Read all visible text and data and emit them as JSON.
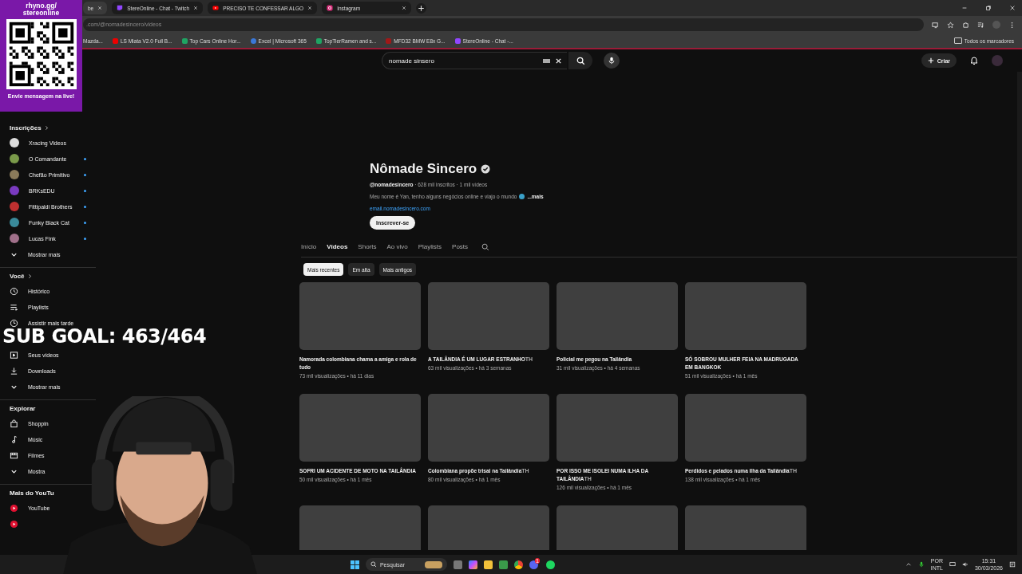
{
  "browser": {
    "tabs": [
      {
        "title": "be",
        "kind": "none",
        "selected": true
      },
      {
        "title": "StereOnline - Chat - Twitch",
        "kind": "twitch",
        "selected": false
      },
      {
        "title": "PRECISO TE CONFESSAR ALGO",
        "kind": "youtube",
        "selected": false
      },
      {
        "title": "Instagram",
        "kind": "instagram",
        "selected": false
      }
    ],
    "address": ".com/@nomadesincero/videos",
    "bookmarks": [
      {
        "title": "Mazda...",
        "kind": "none"
      },
      {
        "title": "LS Miata V2.0 Full B...",
        "kind": "youtube"
      },
      {
        "title": "Top Cars Online Hor...",
        "kind": "sheet"
      },
      {
        "title": "Excel | Microsoft 365",
        "kind": "office"
      },
      {
        "title": "TopTierRamen and s...",
        "kind": "sheet"
      },
      {
        "title": "MFD32 BMW E8x G...",
        "kind": "car"
      },
      {
        "title": "StereOnline - Chat -...",
        "kind": "twitch"
      }
    ],
    "all_bookmarks": "Todos os marcadores"
  },
  "header": {
    "search": {
      "value": "nomade sinsero"
    },
    "create_button": "Criar"
  },
  "sidebar": [
    {
      "title": "Inscrições",
      "items": [
        {
          "label": "Xracing Videos",
          "kind": "avatar",
          "new": false
        },
        {
          "label": "O Comandante",
          "kind": "avatar",
          "new": true
        },
        {
          "label": "Chefão Primitivo",
          "kind": "avatar",
          "new": true
        },
        {
          "label": "BRKsEDU",
          "kind": "avatar",
          "new": true
        },
        {
          "label": "Fittipaldi Brothers",
          "kind": "avatar",
          "new": true
        },
        {
          "label": "Funky Black Cat",
          "kind": "avatar",
          "new": true
        },
        {
          "label": "Lucas Fink",
          "kind": "avatar",
          "new": true
        },
        {
          "label": "Mostrar mais",
          "kind": "more"
        }
      ]
    },
    {
      "title": "Você",
      "items": [
        {
          "label": "Histórico",
          "kind": "history"
        },
        {
          "label": "Playlists",
          "kind": "playlists"
        },
        {
          "label": "Assistir mais tarde",
          "kind": "clock"
        },
        {
          "kind": "hidden"
        },
        {
          "label": "Seus vídeos",
          "kind": "video"
        },
        {
          "label": "Downloads",
          "kind": "download"
        },
        {
          "label": "Mostrar mais",
          "kind": "more"
        }
      ]
    },
    {
      "title": "Explorar",
      "items": [
        {
          "label": "Shoppin",
          "kind": "bag"
        },
        {
          "label": "Músic",
          "kind": "music"
        },
        {
          "label": "Filmes",
          "kind": "film"
        },
        {
          "label": "Mostra",
          "kind": "more"
        }
      ]
    },
    {
      "title": "Mais do YouTu",
      "items": [
        {
          "label": "YouTube",
          "kind": "youtube"
        },
        {
          "kind": "youtube"
        }
      ]
    }
  ],
  "channel": {
    "name": "Nômade Sincero",
    "verified": true,
    "handle": "@nomadesincero",
    "stats": "· 628 mil inscritos · 1 mil vídeos",
    "description": "Meu nome é Yan, tenho alguns negócios online e viajo o mundo",
    "more": "...mais",
    "link": "email.nomadesincero.com",
    "subscribe_button": "Inscrever-se",
    "tabs": [
      {
        "label": "Início",
        "selected": false
      },
      {
        "label": "Vídeos",
        "selected": true
      },
      {
        "label": "Shorts",
        "selected": false
      },
      {
        "label": "Ao vivo",
        "selected": false
      },
      {
        "label": "Playlists",
        "selected": false
      },
      {
        "label": "Posts",
        "selected": false
      }
    ],
    "chips": [
      {
        "label": "Mais recentes",
        "selected": true
      },
      {
        "label": "Em alta",
        "selected": false
      },
      {
        "label": "Mais antigos",
        "selected": false
      }
    ]
  },
  "videos": [
    {
      "title": "Namorada colombiana chama a amiga e rola de tudo",
      "meta": "73 mil visualizações • há 11 dias"
    },
    {
      "title": "A TAILÂNDIA É UM LUGAR ESTRANHO",
      "badge": "TH",
      "meta": "63 mil visualizações • há 3 semanas"
    },
    {
      "title": "Policial me pegou na Tailândia",
      "meta": "31 mil visualizações • há 4 semanas"
    },
    {
      "title": "SÓ SOBROU MULHER FEIA NA MADRUGADA EM BANGKOK",
      "meta": "51 mil visualizações • há 1 mês"
    },
    {
      "title": "SOFRI UM ACIDENTE DE MOTO NA TAILÂNDIA",
      "meta": "50 mil visualizações • há 1 mês"
    },
    {
      "title": "Colombiana propõe trisal na Tailândia",
      "badge": "TH",
      "meta": "80 mil visualizações • há 1 mês"
    },
    {
      "title": "POR ISSO ME ISOLEI NUMA ILHA DA TAILÂNDIA",
      "badge": "TH",
      "meta": "126 mil visualizações • há 1 mês"
    },
    {
      "title": "Perdidos e pelados numa ilha da Tailândia",
      "badge": "TH",
      "meta": "138 mil visualizações • há 1 mês"
    },
    {
      "kind": "thumbnail"
    },
    {
      "kind": "thumbnail"
    },
    {
      "kind": "thumbnail"
    },
    {
      "kind": "thumbnail"
    }
  ],
  "overlay": {
    "qr_title": "rhyno.gg/ stereonline",
    "qr_caption": "Envie mensagem na live!",
    "sub_goal": "SUB GOAL: 463/464"
  },
  "taskbar": {
    "search": "Pesquisar",
    "discord_badge": "1",
    "language": "POR",
    "layout": "INTL",
    "time": "15:31",
    "date": "30/03/2026"
  }
}
